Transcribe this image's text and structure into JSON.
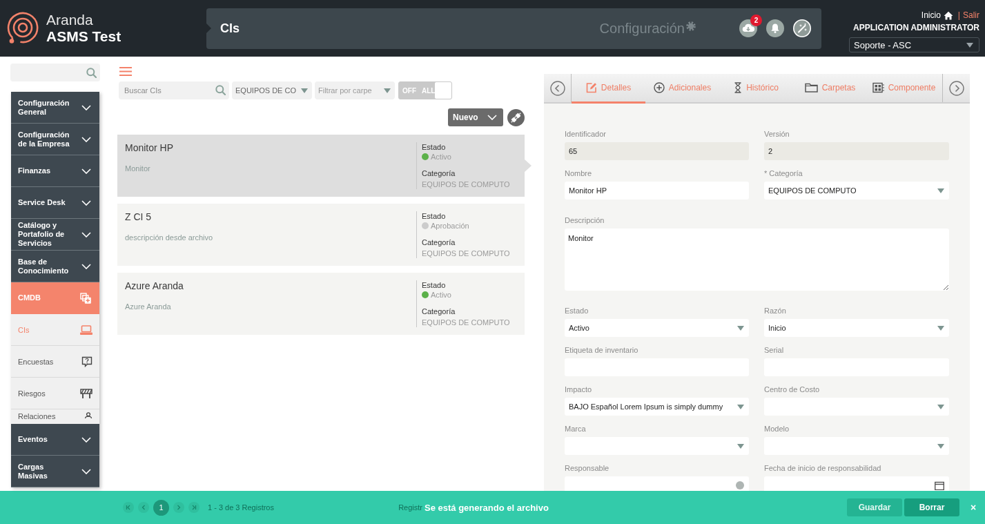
{
  "header": {
    "brand_line_1": "Aranda",
    "brand_line_2": "ASMS Test",
    "page_title": "CIs",
    "section": "Configuración",
    "download_badge": "2",
    "home_link": "Inicio",
    "separator": "|",
    "logout_link": "Salir",
    "role": "APPLICATION ADMINISTRATOR",
    "project_select": "Soporte - ASC"
  },
  "sidebar": {
    "items": [
      {
        "label": "Configuración General",
        "selected": false,
        "expanded": false
      },
      {
        "label": "Configuración de la Empresa",
        "selected": false,
        "expanded": false
      },
      {
        "label": "Finanzas",
        "selected": false,
        "expanded": false
      },
      {
        "label": "Service Desk",
        "selected": false,
        "expanded": false
      },
      {
        "label": "Catálogo y Portafolio de Servicios",
        "selected": false,
        "expanded": false
      },
      {
        "label": "Base de Conocimiento",
        "selected": false,
        "expanded": false
      },
      {
        "label": "CMDB",
        "selected": true,
        "expanded": true,
        "children": [
          {
            "label": "CIs",
            "selected": true
          },
          {
            "label": "Encuestas",
            "selected": false
          },
          {
            "label": "Riesgos",
            "selected": false
          },
          {
            "label": "Relaciones",
            "selected": false
          }
        ]
      },
      {
        "label": "Eventos",
        "selected": false,
        "expanded": false
      },
      {
        "label": "Cargas Masivas",
        "selected": false,
        "expanded": false
      }
    ]
  },
  "list_panel": {
    "search": {
      "placeholder": "Buscar CIs"
    },
    "filters": [
      {
        "value": "EQUIPOS DE CO"
      },
      {
        "placeholder": "Filtrar por carpe"
      }
    ],
    "toggle": {
      "off_label": "OFF",
      "on_label": "ALL",
      "on": false
    },
    "new_button": "Nuevo",
    "items": [
      {
        "title": "Monitor HP",
        "description": "Monitor",
        "status_label": "Estado",
        "status": "Activo",
        "color": "#5cb14a",
        "category_label": "Categoría",
        "category": "EQUIPOS DE COMPUTO",
        "selected": true
      },
      {
        "title": "Z CI 5",
        "description": "descripción desde archivo",
        "status_label": "Estado",
        "status": "Aprobación",
        "color": "#cccccc",
        "category_label": "Categoría",
        "category": "EQUIPOS DE COMPUTO",
        "selected": false
      },
      {
        "title": "Azure Aranda",
        "description": "Azure Aranda",
        "status_label": "Estado",
        "status": "Activo",
        "color": "#5cb14a",
        "category_label": "Categoría",
        "category": "EQUIPOS DE COMPUTO",
        "selected": false
      }
    ]
  },
  "detail_panel": {
    "tabs": [
      {
        "label": "Detalles",
        "selected": true
      },
      {
        "label": "Adicionales",
        "selected": false
      },
      {
        "label": "Histórico",
        "selected": false
      },
      {
        "label": "Carpetas",
        "selected": false
      },
      {
        "label": "Componente",
        "selected": false
      }
    ],
    "fields": [
      {
        "label": "Identificador",
        "kind": "readonly",
        "value": "65"
      },
      {
        "label": "Versión",
        "kind": "readonly",
        "value": "2"
      },
      {
        "label": "Nombre",
        "kind": "input",
        "value": "Monitor HP"
      },
      {
        "label": "* Categoría",
        "kind": "select",
        "value": "EQUIPOS DE COMPUTO"
      },
      {
        "label": "Descripción",
        "kind": "textarea",
        "value": "Monitor"
      },
      {
        "label": "Estado",
        "kind": "select",
        "value": "Activo"
      },
      {
        "label": "Razón",
        "kind": "select",
        "value": "Inicio"
      },
      {
        "label": "Etiqueta de inventario",
        "kind": "input"
      },
      {
        "label": "Serial",
        "kind": "input"
      },
      {
        "label": "Impacto",
        "kind": "select",
        "value": "BAJO Español Lorem Ipsum is simply dummy"
      },
      {
        "label": "Centro de Costo",
        "kind": "select"
      },
      {
        "label": "Marca",
        "kind": "select"
      },
      {
        "label": "Modelo",
        "kind": "select"
      },
      {
        "label": "Responsable",
        "kind": "lookup"
      },
      {
        "label": "Fecha de inicio de responsabilidad",
        "kind": "date"
      }
    ]
  },
  "footer": {
    "pagination": {
      "pages": [
        {
          "label": "1",
          "selected": true
        }
      ],
      "summary": "1 - 3 de 3 Registros",
      "page_size_label": "Registr"
    },
    "toast": {
      "message": "Se está generando el archivo",
      "close": "×"
    },
    "actions": [
      {
        "label": "Guardar",
        "disabled": true
      },
      {
        "label": "Borrar",
        "disabled": false
      }
    ]
  }
}
